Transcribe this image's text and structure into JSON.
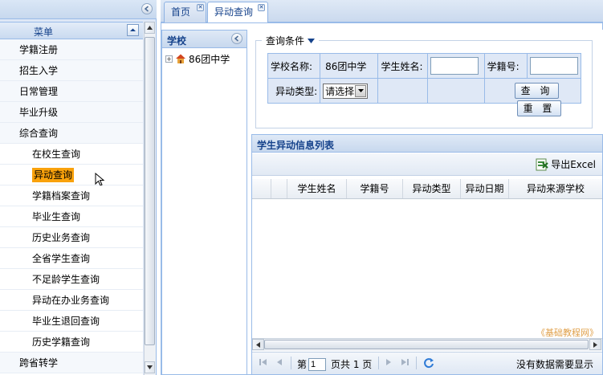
{
  "left_menu": {
    "title": "菜单",
    "items": [
      {
        "label": "学籍注册",
        "level": "top"
      },
      {
        "label": "招生入学",
        "level": "top"
      },
      {
        "label": "日常管理",
        "level": "top"
      },
      {
        "label": "毕业升级",
        "level": "top"
      },
      {
        "label": "综合查询",
        "level": "top"
      },
      {
        "label": "在校生查询",
        "level": "sub"
      },
      {
        "label": "异动查询",
        "level": "sub",
        "selected": true
      },
      {
        "label": "学籍档案查询",
        "level": "sub"
      },
      {
        "label": "毕业生查询",
        "level": "sub"
      },
      {
        "label": "历史业务查询",
        "level": "sub"
      },
      {
        "label": "全省学生查询",
        "level": "sub"
      },
      {
        "label": "不足龄学生查询",
        "level": "sub"
      },
      {
        "label": "异动在办业务查询",
        "level": "sub"
      },
      {
        "label": "毕业生退回查询",
        "level": "sub"
      },
      {
        "label": "历史学籍查询",
        "level": "sub"
      },
      {
        "label": "跨省转学",
        "level": "top"
      }
    ]
  },
  "tabs": [
    {
      "label": "首页",
      "active": false
    },
    {
      "label": "异动查询",
      "active": true
    }
  ],
  "school_panel": {
    "title": "学校",
    "node_label": "86团中学"
  },
  "query": {
    "legend": "查询条件",
    "school_name_label": "学校名称:",
    "school_name_value": "86团中学",
    "student_name_label": "学生姓名:",
    "student_name_value": "",
    "student_no_label": "学籍号:",
    "student_no_value": "",
    "change_type_label": "异动类型:",
    "change_type_selected": "请选择",
    "search_button": "查 询",
    "reset_button": "重 置"
  },
  "grid": {
    "title": "学生异动信息列表",
    "export_label": "导出Excel",
    "columns": [
      "学生姓名",
      "学籍号",
      "异动类型",
      "异动日期",
      "异动来源学校"
    ],
    "rows": []
  },
  "pager": {
    "page_prefix": "第",
    "page_value": "1",
    "page_suffix": "页共 1 页",
    "status": "没有数据需要显示"
  },
  "watermark": "《基础教程网》",
  "colors": {
    "accent": "#15428b",
    "selected": "#f9a20c",
    "border": "#99bbe8",
    "panel": "#dfe8f6"
  }
}
